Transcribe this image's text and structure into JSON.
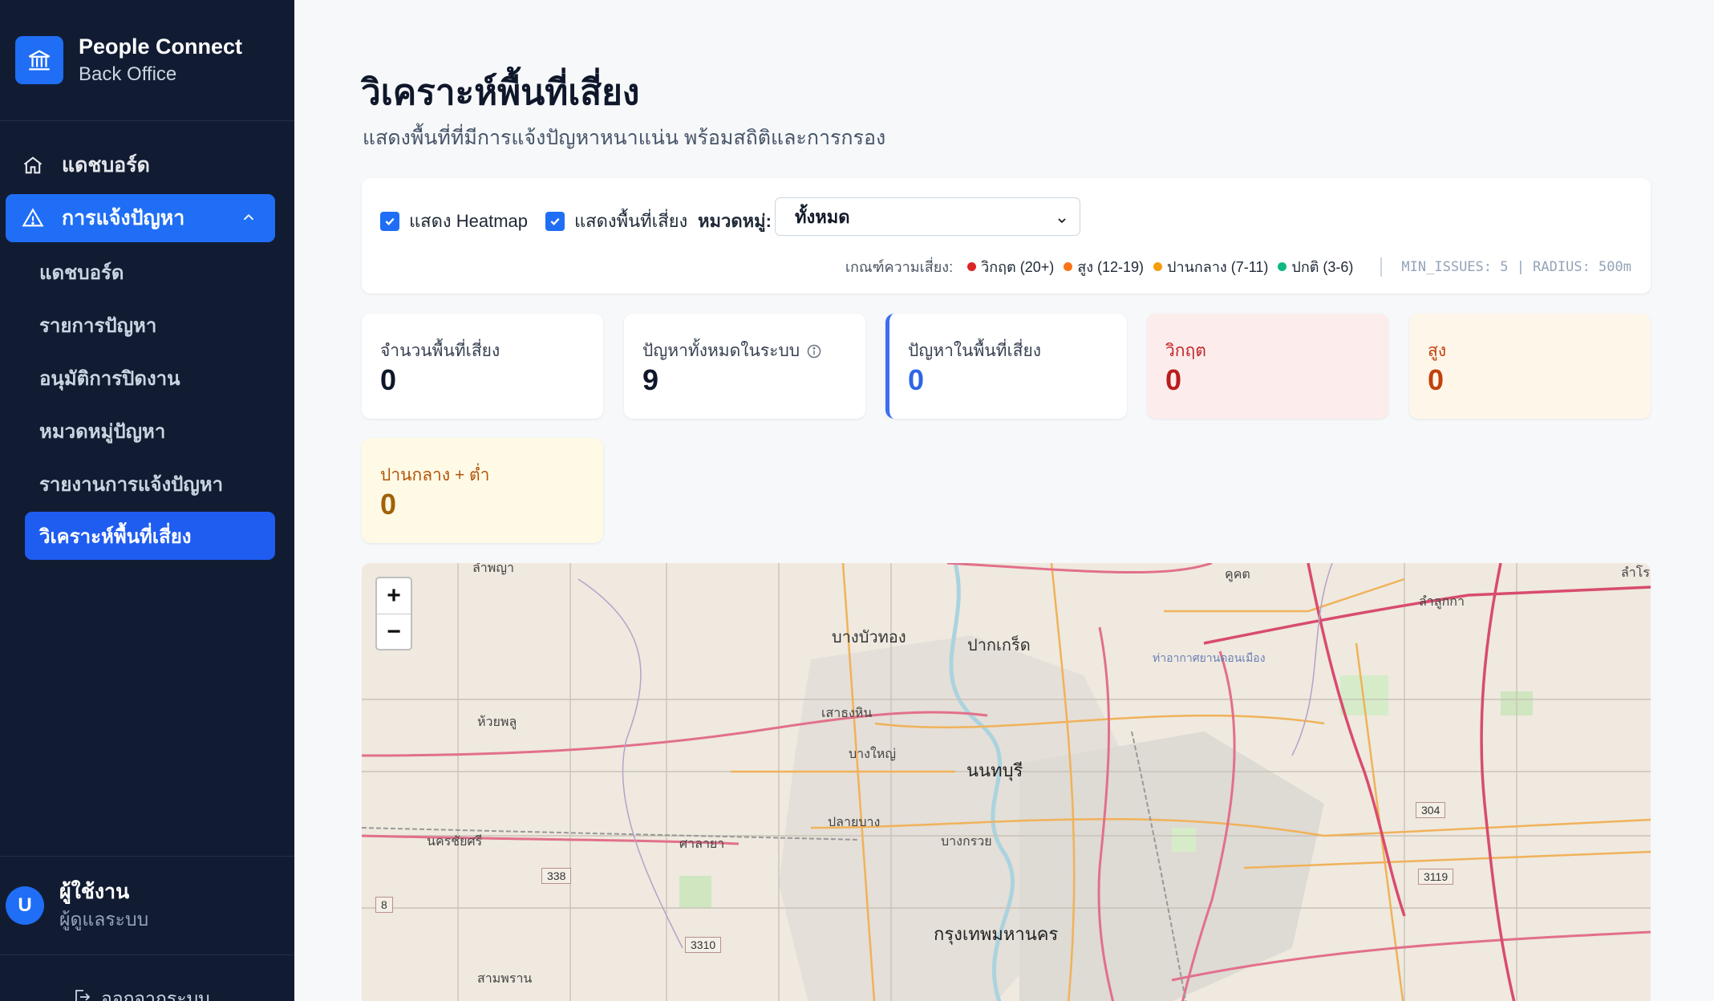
{
  "brand": {
    "name": "People Connect",
    "sub": "Back Office"
  },
  "nav": {
    "dashboard": "แดชบอร์ด",
    "issues": "การแจ้งปัญหา",
    "sub_items": [
      "แดชบอร์ด",
      "รายการปัญหา",
      "อนุมัติการปิดงาน",
      "หมวดหมู่ปัญหา",
      "รายงานการแจ้งปัญหา",
      "วิเคราะห์พื้นที่เสี่ยง"
    ]
  },
  "user": {
    "avatar": "U",
    "name": "ผู้ใช้งาน",
    "role": "ผู้ดูแลระบบ",
    "logout": "ออกจากระบบ"
  },
  "page": {
    "title": "วิเคราะห์พื้นที่เสี่ยง",
    "subtitle": "แสดงพื้นที่ที่มีการแจ้งปัญหาหนาแน่น พร้อมสถิติและการกรอง"
  },
  "filters": {
    "show_heatmap": "แสดง Heatmap",
    "show_risk": "แสดงพื้นที่เสี่ยง",
    "category_label": "หมวดหมู่:",
    "category_value": "ทั้งหมด"
  },
  "legend": {
    "title": "เกณฑ์ความเสี่ยง:",
    "items": [
      {
        "label": "วิกฤต (20+)",
        "color": "#dc2626"
      },
      {
        "label": "สูง (12-19)",
        "color": "#f97316"
      },
      {
        "label": "ปานกลาง (7-11)",
        "color": "#f59e0b"
      },
      {
        "label": "ปกติ (3-6)",
        "color": "#10b981"
      }
    ],
    "params": "MIN_ISSUES: 5 | RADIUS: 500m"
  },
  "stats": {
    "risk_areas": {
      "label": "จำนวนพื้นที่เสี่ยง",
      "value": "0"
    },
    "total_issues": {
      "label": "ปัญหาทั้งหมดในระบบ",
      "value": "9"
    },
    "issues_in_risk": {
      "label": "ปัญหาในพื้นที่เสี่ยง",
      "value": "0"
    },
    "critical": {
      "label": "วิกฤต",
      "value": "0"
    },
    "high": {
      "label": "สูง",
      "value": "0"
    },
    "medium_low": {
      "label": "ปานกลาง + ต่ำ",
      "value": "0"
    }
  },
  "map": {
    "zoom_in": "+",
    "zoom_out": "−",
    "labels": {
      "bang_bua_thong": "บางบัวทอง",
      "pak_kret": "ปากเกร็ด",
      "nonthaburi": "นนทบุรี",
      "bangkok": "กรุงเทพมหานคร",
      "bang_yai": "บางใหญ่",
      "sao_thong_hin": "เสาธงหิน",
      "huai_phlu": "ห้วยพลู",
      "nakhon_chai_si": "นครชัยศรี",
      "sala_ya": "ศาลายา",
      "pla_i_bang": "ปลายบาง",
      "bang_kruai": "บางกรวย",
      "lam_luk_ka": "ลำลูกกา",
      "sam_phran": "สามพราน",
      "khu_khot": "คูคต",
      "lam_phaya": "ลำพญา",
      "lam_to": "ลำโร",
      "don_mueang": "ท่าอากาศยานดอนเมือง"
    },
    "shields": [
      "338",
      "8",
      "3310",
      "304",
      "3119"
    ]
  }
}
